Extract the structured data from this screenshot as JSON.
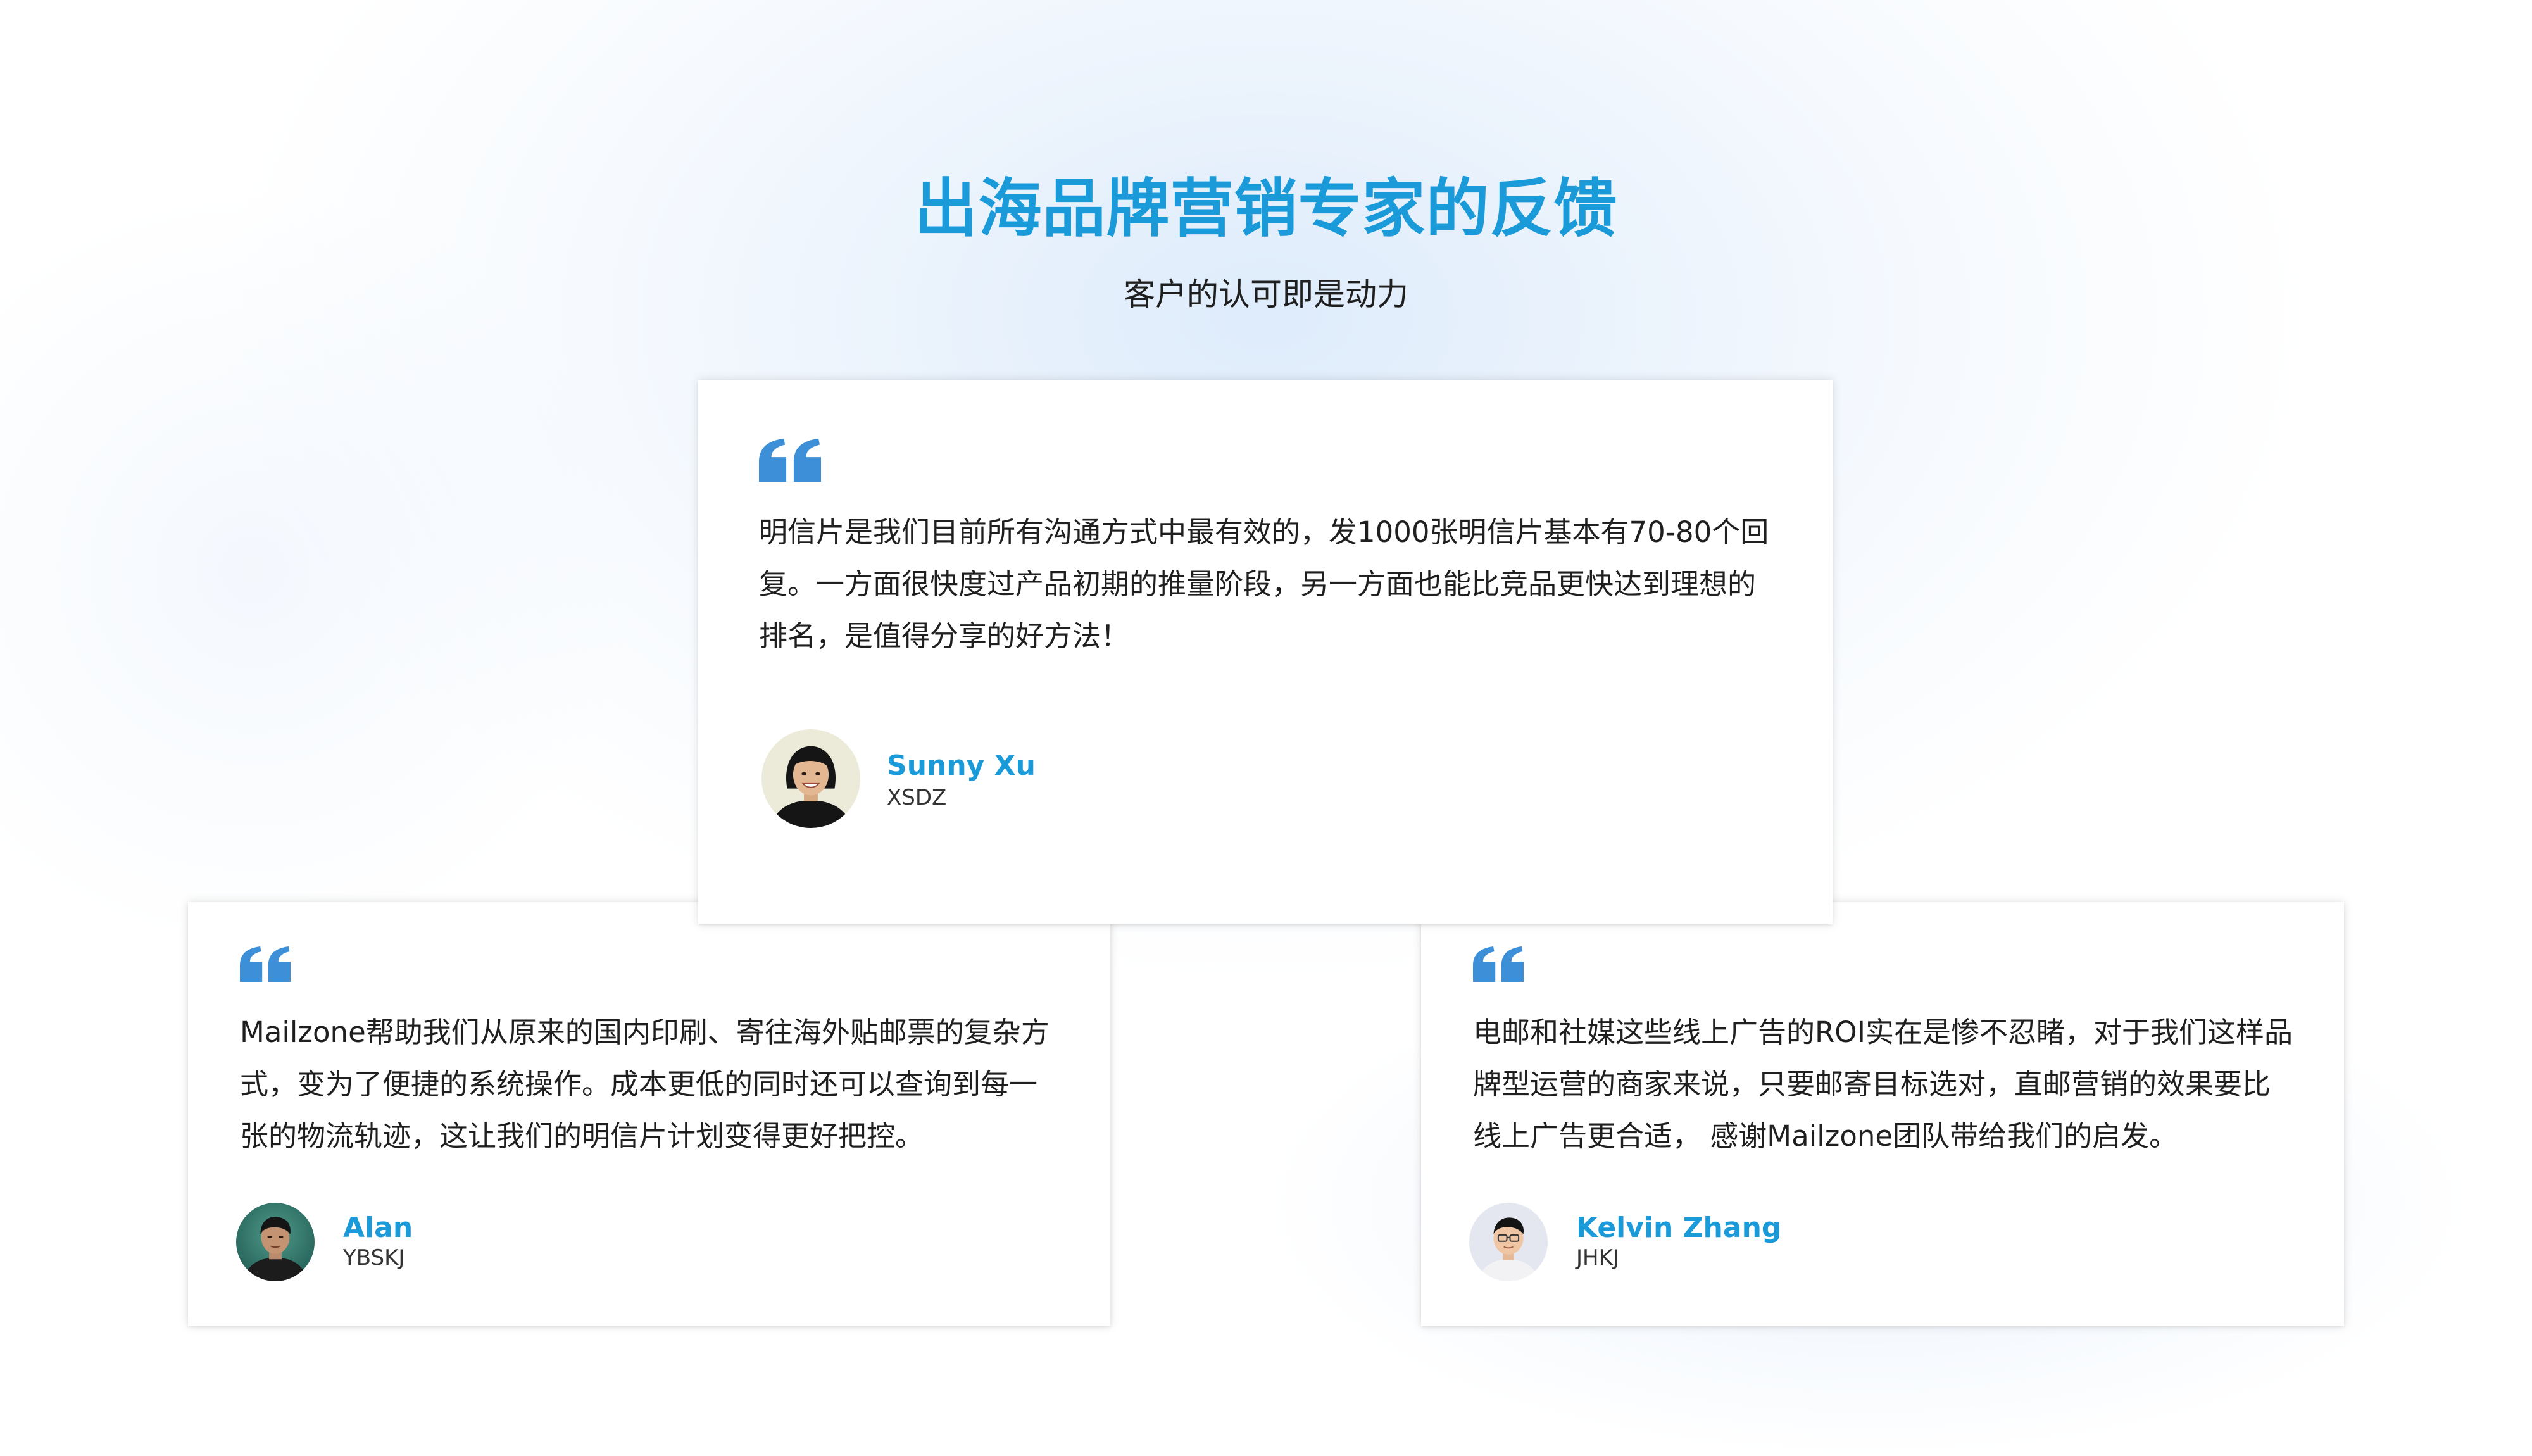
{
  "header": {
    "title": "出海品牌营销专家的反馈",
    "subtitle": "客户的认可即是动力"
  },
  "colors": {
    "accent": "#1a9ad8",
    "quote_mark": "#3d8fd8",
    "text": "#1f1f1f"
  },
  "testimonials": [
    {
      "quote": "明信片是我们目前所有沟通方式中最有效的，发1000张明信片基本有70-80个回复。一方面很快度过产品初期的推量阶段，另一方面也能比竞品更快达到理想的排名，是值得分享的好方法！",
      "name": "Sunny Xu",
      "company": "XSDZ",
      "icon": "quote-icon"
    },
    {
      "quote": "Mailzone帮助我们从原来的国内印刷、寄往海外贴邮票的复杂方式，变为了便捷的系统操作。成本更低的同时还可以查询到每一张的物流轨迹，这让我们的明信片计划变得更好把控。",
      "name": "Alan",
      "company": "YBSKJ",
      "icon": "quote-icon"
    },
    {
      "quote": "电邮和社媒这些线上广告的ROI实在是惨不忍睹，对于我们这样品牌型运营的商家来说，只要邮寄目标选对，直邮营销的效果要比线上广告更合适，  感谢Mailzone团队带给我们的启发。",
      "name": "Kelvin Zhang",
      "company": "JHKJ",
      "icon": "quote-icon"
    }
  ]
}
